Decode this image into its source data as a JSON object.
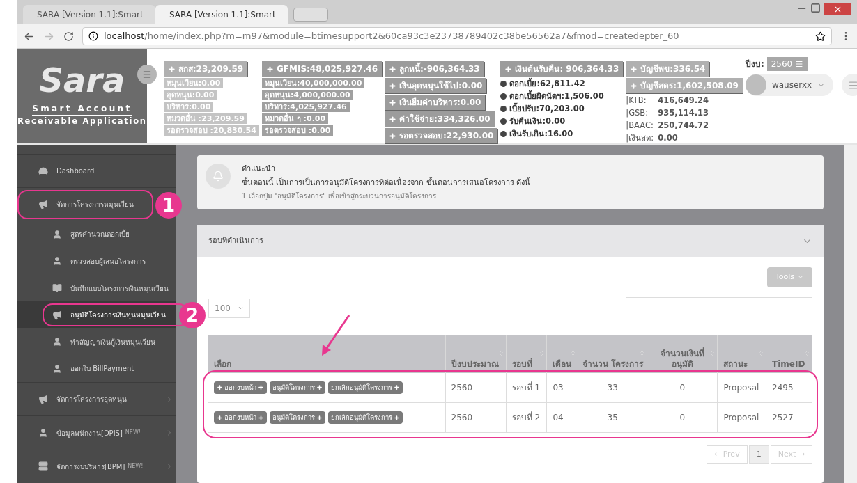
{
  "browser": {
    "tabs": [
      {
        "title": "SARA [Version 1.1]:Smart",
        "selected": false
      },
      {
        "title": "SARA [Version 1.1]:Smart",
        "selected": true
      }
    ],
    "url_host": "localhost",
    "url_path": "/home/index.php?m=m97&module=btimesupport2&60ca93c3e23738789402c38be56562a7&fmod=createdepter_60"
  },
  "logo": {
    "name": "Sara",
    "line1": "Smart Account",
    "line2": "Receivable Application"
  },
  "stats": [
    {
      "items": [
        {
          "kind": "button",
          "text": "สกส:23,209.59"
        },
        {
          "kind": "tag",
          "text": "หมุนเวียน:0.00"
        },
        {
          "kind": "tag",
          "text": "อุดหนุน:0.00"
        },
        {
          "kind": "tag",
          "text": "บริหาร:0.00"
        },
        {
          "kind": "tag",
          "text": "หมวดอื่น :23,209.59"
        },
        {
          "kind": "tag",
          "text": "รอตรวจสอบ :20,830.54"
        }
      ]
    },
    {
      "items": [
        {
          "kind": "button",
          "text": "GFMIS:48,025,927.46"
        },
        {
          "kind": "tag",
          "text": "หมุนเวียน:40,000,000.00"
        },
        {
          "kind": "tag",
          "text": "อุดหนุน:4,000,000.00"
        },
        {
          "kind": "tag",
          "text": "บริหาร:4,025,927.46"
        },
        {
          "kind": "tag",
          "text": "หมวดอื่น ๆ :0.00"
        },
        {
          "kind": "tag",
          "text": "รอตรวจสอบ :0.00"
        }
      ]
    },
    {
      "items": [
        {
          "kind": "button",
          "text": "ลูกหนี้:-906,364.33"
        },
        {
          "kind": "button",
          "text": "เงินอุดหนุนใช้ไป:0.00"
        },
        {
          "kind": "button",
          "text": "เงินยืมค่าบริหาร:0.00"
        },
        {
          "kind": "button",
          "text": "ค่าใช้จ่าย:334,326.00"
        },
        {
          "kind": "button",
          "text": "รอตรวจสอบ:22,930.00"
        }
      ]
    },
    {
      "items": [
        {
          "kind": "button",
          "text": "เงินต้นรับคืน: 906,364.33"
        },
        {
          "kind": "dot",
          "text": "ดอกเบี้ย:62,811.42"
        },
        {
          "kind": "dot",
          "text": "ดอกเบี้ยผิดนัดฯ:1,506.00"
        },
        {
          "kind": "dot",
          "text": "เบี้ยปรับ:70,203.00"
        },
        {
          "kind": "dot",
          "text": "รับคืนเงิน:0.00"
        },
        {
          "kind": "dot",
          "text": "เงินรับเกิน:16.00"
        }
      ]
    },
    {
      "items": [
        {
          "kind": "button",
          "text": "บัญชีพข:336.54"
        },
        {
          "kind": "button",
          "text": "บัญชีสดร:1,602,508.09"
        },
        {
          "kind": "bank",
          "label": "|KTB:",
          "text": "416,649.24"
        },
        {
          "kind": "bank",
          "label": "|GSB:",
          "text": "935,114.13"
        },
        {
          "kind": "bank",
          "label": "|BAAC:",
          "text": "250,744.72"
        },
        {
          "kind": "bank",
          "label": "|เงินสด:",
          "text": "0.00"
        }
      ]
    }
  ],
  "user": {
    "year_label": "ปีงบ:",
    "year": "2560",
    "name": "wauserxx"
  },
  "sidebar": [
    {
      "label": "Dashboard",
      "kind": "dashboard",
      "selected": false
    },
    {
      "label": "จัดการโครงการหมุนเวียน",
      "kind": "megaphone",
      "selected": false,
      "callout": "1",
      "expanded": true,
      "children": [
        {
          "label": "สูตรคำนวณดอกเบี้ย",
          "kind": "user",
          "selected": false
        },
        {
          "label": "ตรวจสอบผู้เสนอโครงการ",
          "kind": "user",
          "selected": false
        },
        {
          "label": "บันทึกแบบโครงการเงินหมุนเวียน",
          "kind": "book",
          "selected": false
        },
        {
          "label": "อนุมัติโครงการเงินทุนหมุนเวียน",
          "kind": "megaphone",
          "selected": true,
          "callout": "2"
        },
        {
          "label": "ทำสัญญาเงินกู้เงินหมุนเวียน",
          "kind": "user",
          "selected": false
        },
        {
          "label": "ออกใบ BillPayment",
          "kind": "user",
          "selected": false
        }
      ]
    },
    {
      "label": "จัดการโครงการอุดหนุน",
      "kind": "megaphone",
      "selected": false,
      "expanded": false
    },
    {
      "label": "ข้อมูลพนักงาน[DPIS]",
      "badge": "NEW!",
      "kind": "user",
      "selected": false,
      "expanded": false
    },
    {
      "label": "จัดการงบบริหาร[BPM]",
      "badge": "NEW!",
      "kind": "server",
      "selected": false,
      "expanded": false
    }
  ],
  "notice": {
    "title": "คำแนะนำ",
    "text": "ขั้นตอนนี้ เป็นการเป็นการอนุมัติโครงการที่ต่อเนื่องจาก ขั้นตอนการเสนอโครงการ ดังนี้",
    "step": "1 เลือกปุ่ม \"อนุมัติโครงการ\" เพื่อเข้าสู่กระบวนการอนุมัติโครงการ"
  },
  "panel": {
    "title": "รอบที่ดำเนินการ",
    "tools": "Tools",
    "page_size": "100",
    "table": {
      "highlighted": true,
      "columns": [
        "เลือก",
        "ปีงบประมาณ",
        "รอบที่",
        "เดือน",
        "จำนวน โครงการ",
        "จำนวนเงินที่ อนุมัติ",
        "สถานะ",
        "TimeID"
      ],
      "rows": [
        {
          "cells": [
            {
              "buttons": [
                "ออกงบหน้า",
                "อนุมัติโครงการ",
                "ยกเลิกอนุมัติโครงการ"
              ]
            },
            "2560",
            "รอบที่ 1",
            "03",
            "33",
            "0",
            "Proposal",
            "2495"
          ]
        },
        {
          "cells": [
            {
              "buttons": [
                "ออกงบหน้า",
                "อนุมัติโครงการ",
                "ยกเลิกอนุมัติโครงการ"
              ]
            },
            "2560",
            "รอบที่ 2",
            "04",
            "35",
            "0",
            "Proposal",
            "2527"
          ]
        }
      ]
    },
    "pagination": [
      {
        "label": "← Prev",
        "selected": false
      },
      {
        "label": "1",
        "selected": true
      },
      {
        "label": "Next →",
        "selected": false
      }
    ]
  }
}
